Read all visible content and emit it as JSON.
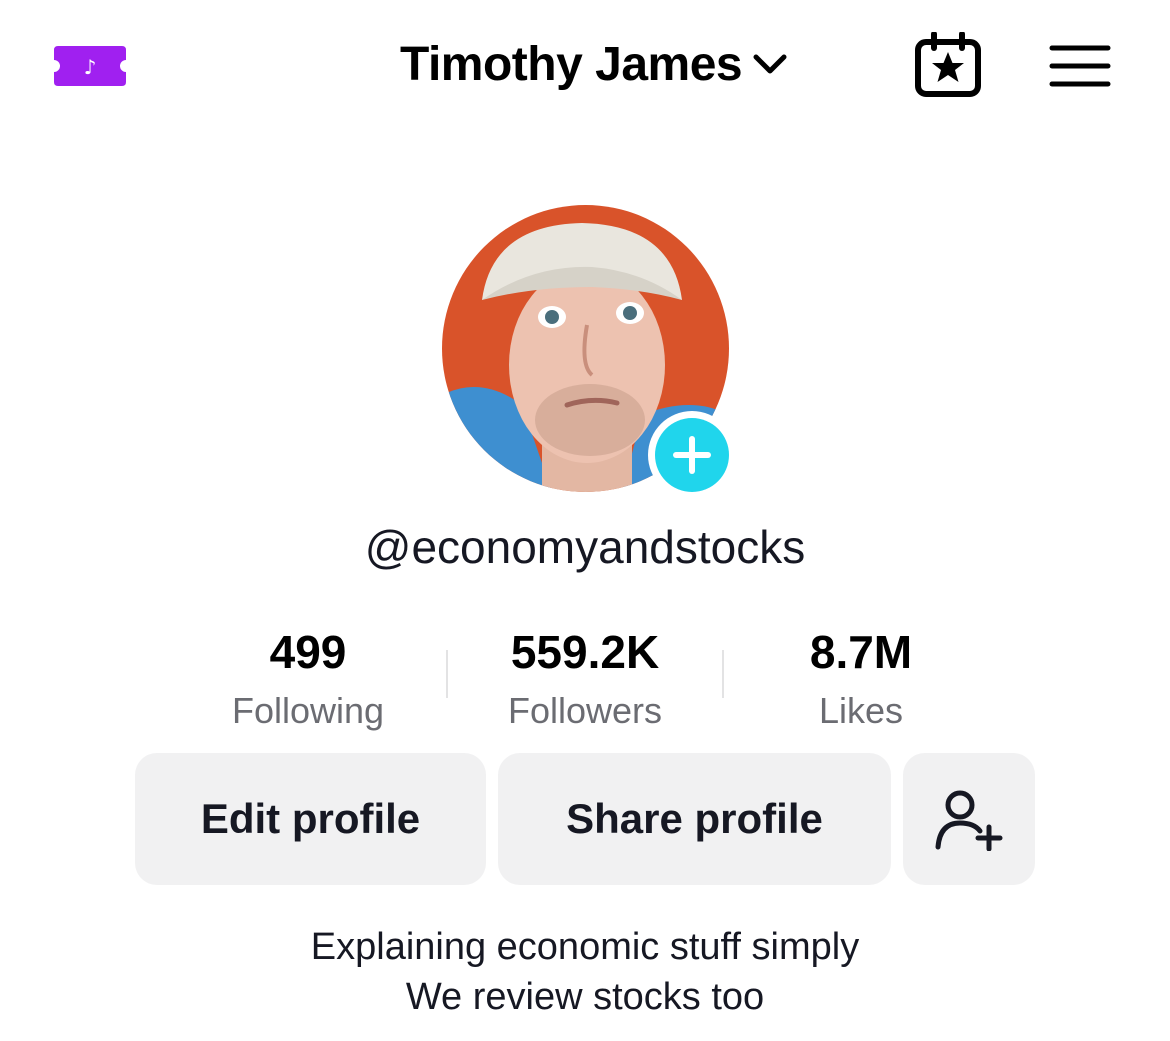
{
  "header": {
    "username_title": "Timothy James"
  },
  "profile": {
    "handle": "@economyandstocks"
  },
  "stats": [
    {
      "value": "499",
      "label": "Following"
    },
    {
      "value": "559.2K",
      "label": "Followers"
    },
    {
      "value": "8.7M",
      "label": "Likes"
    }
  ],
  "actions": {
    "edit_label": "Edit profile",
    "share_label": "Share profile"
  },
  "bio": {
    "line1": "Explaining economic stuff simply",
    "line2": "We review stocks too"
  },
  "icons": {
    "ticket": "tiktok-ticket-icon",
    "dropdown": "chevron-down-icon",
    "calendar": "calendar-star-icon",
    "menu": "hamburger-menu-icon",
    "add_photo": "plus-badge-icon",
    "add_friend": "add-friend-icon"
  },
  "colors": {
    "ticket_purple": "#A020F0",
    "plus_badge": "#20D5EC",
    "button_bg": "#F1F1F2",
    "secondary_text": "#6B6C72"
  }
}
